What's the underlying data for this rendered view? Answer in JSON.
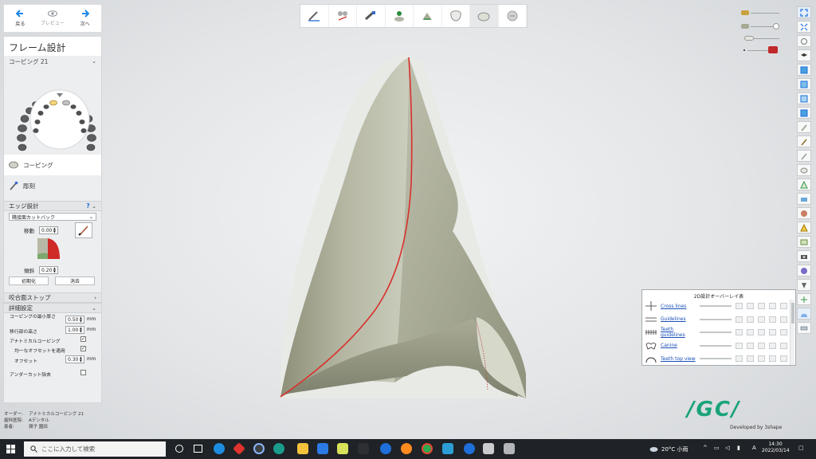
{
  "nav": {
    "back": "戻る",
    "preview": "プレビュー",
    "next": "次へ"
  },
  "panel": {
    "title": "フレーム設計",
    "subtitle": "コーピング 21",
    "steps": [
      "コーピング",
      "彫刻"
    ]
  },
  "edge": {
    "header": "エッジ設計",
    "help": "?",
    "mode": "隣接面カットバック",
    "move_label": "移動",
    "move_value": "0.00",
    "angle_label": "傾斜",
    "angle_value": "0.20",
    "reset_button": "初期化",
    "delete_button": "消去"
  },
  "occlusal": {
    "header": "咬合面ストップ"
  },
  "details": {
    "header": "詳細設定",
    "min_thickness_label": "コーピングの最小厚さ",
    "min_thickness_value": "0.50",
    "margin_height_label": "移行部の高さ",
    "margin_height_value": "1.00",
    "anatomical_label": "アナトミカルコーピング",
    "offset_toggle_label": "均一なオフセットを適用",
    "offset_label": "オフセット",
    "offset_value": "0.30",
    "undercut_label": "アンダーカット除去",
    "unit": "mm"
  },
  "info": {
    "order_label": "オーダー:",
    "order_value": "アナトミカルコーピング 21",
    "lab_label": "歯科医院:",
    "lab_value": "Aデンタル",
    "patient_label": "患者:",
    "patient_value": "潤子 園田"
  },
  "overlay": {
    "title": "2D設計オーバーレイ表",
    "rows": [
      "Cross lines",
      "Guidelines",
      "Teeth guidelines",
      "Canine",
      "Teeth top view"
    ]
  },
  "brand": {
    "logo": "/GC/",
    "developed": "Developed by 3shape",
    "color": "#1aa37a"
  },
  "taskbar": {
    "search_placeholder": "ここに入力して検索",
    "weather": "20°C 小雨",
    "ime": "A",
    "time": "14:30",
    "date": "2022/03/14"
  },
  "colors": {
    "nav_accent": "#1e88e5",
    "margin_line": "#d9302c",
    "model_fill": "#9a9c86"
  }
}
